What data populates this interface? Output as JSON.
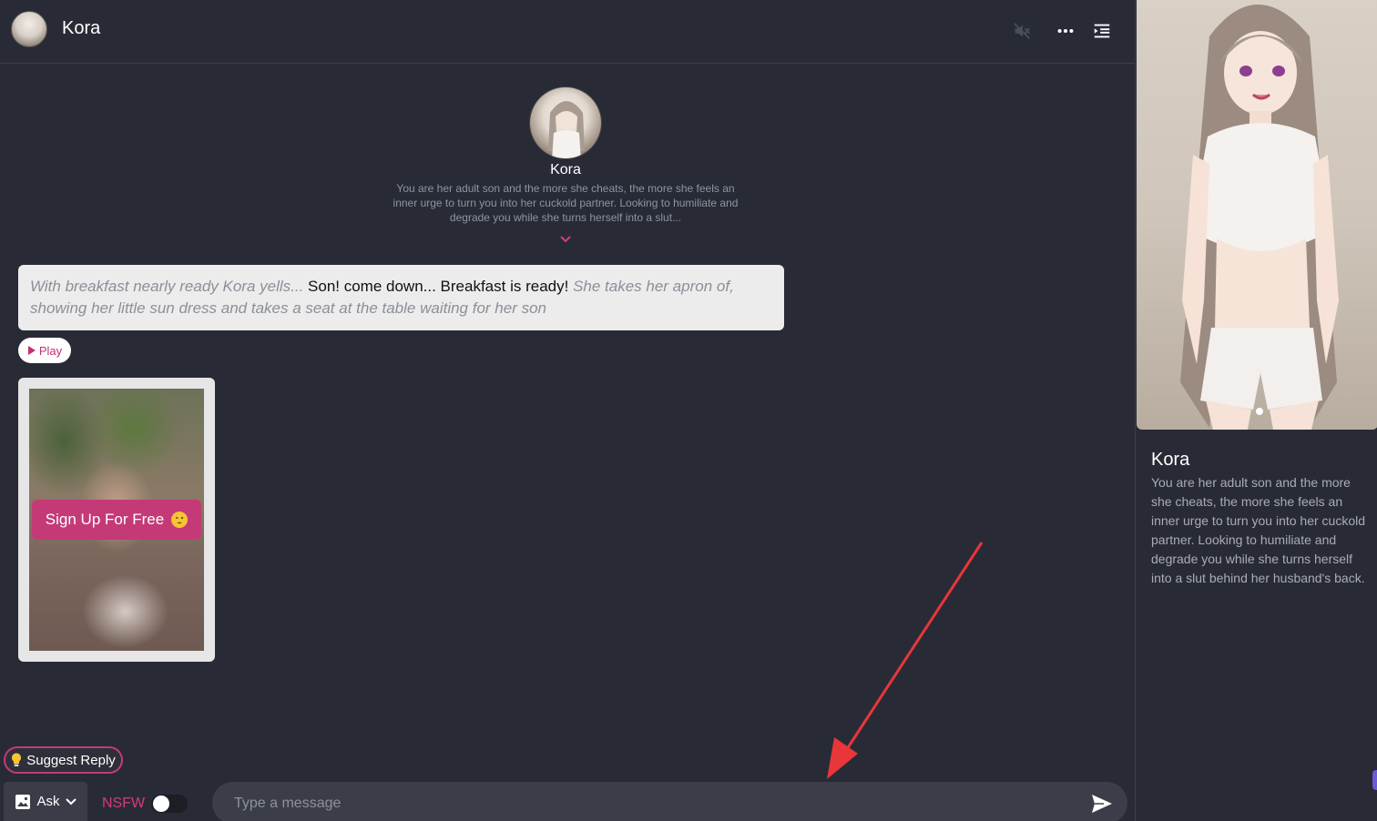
{
  "header": {
    "title": "Kora",
    "icons": [
      "volume-mute-icon",
      "more-icon",
      "menu-collapse-icon"
    ]
  },
  "intro": {
    "name": "Kora",
    "description": "You are her adult son and the more she cheats, the more she feels an inner urge to turn you into her cuckold partner. Looking to humiliate and degrade you while she turns herself into a slut..."
  },
  "message": {
    "action1": "With breakfast nearly ready Kora yells... ",
    "speech": "Son! come down... Breakfast is ready! ",
    "action2": "She takes her apron of, showing her little sun dress and takes a seat at the table waiting for her son",
    "play_label": "Play"
  },
  "locked_image": {
    "signup_label": "Sign Up For Free"
  },
  "composer": {
    "suggest_label": "Suggest Reply",
    "ask_label": "Ask",
    "nsfw_label": "NSFW",
    "nsfw_enabled": false,
    "placeholder": "Type a message"
  },
  "side_panel": {
    "name": "Kora",
    "description": "You are her adult son and the more she cheats, the more she feels an inner urge to turn you into her cuckold partner. Looking to humiliate and degrade you while she turns herself into a slut behind her husband's back."
  },
  "colors": {
    "background": "#282b35",
    "accent": "#c43a77",
    "bubble": "#ececec",
    "annotation": "#e8363b"
  }
}
